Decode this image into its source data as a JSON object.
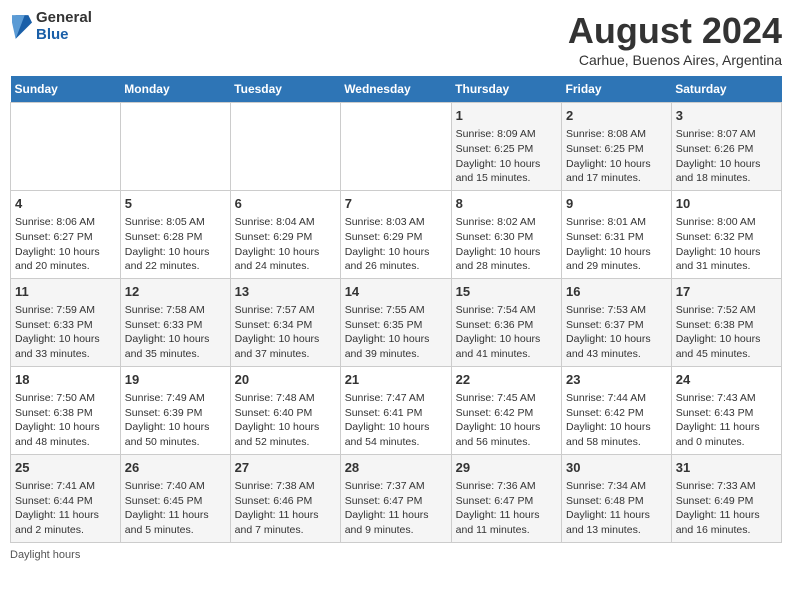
{
  "header": {
    "logo": {
      "general": "General",
      "blue": "Blue"
    },
    "title": "August 2024",
    "subtitle": "Carhue, Buenos Aires, Argentina"
  },
  "days_of_week": [
    "Sunday",
    "Monday",
    "Tuesday",
    "Wednesday",
    "Thursday",
    "Friday",
    "Saturday"
  ],
  "weeks": [
    [
      {
        "day": "",
        "info": ""
      },
      {
        "day": "",
        "info": ""
      },
      {
        "day": "",
        "info": ""
      },
      {
        "day": "",
        "info": ""
      },
      {
        "day": "1",
        "info": "Sunrise: 8:09 AM\nSunset: 6:25 PM\nDaylight: 10 hours\nand 15 minutes."
      },
      {
        "day": "2",
        "info": "Sunrise: 8:08 AM\nSunset: 6:25 PM\nDaylight: 10 hours\nand 17 minutes."
      },
      {
        "day": "3",
        "info": "Sunrise: 8:07 AM\nSunset: 6:26 PM\nDaylight: 10 hours\nand 18 minutes."
      }
    ],
    [
      {
        "day": "4",
        "info": "Sunrise: 8:06 AM\nSunset: 6:27 PM\nDaylight: 10 hours\nand 20 minutes."
      },
      {
        "day": "5",
        "info": "Sunrise: 8:05 AM\nSunset: 6:28 PM\nDaylight: 10 hours\nand 22 minutes."
      },
      {
        "day": "6",
        "info": "Sunrise: 8:04 AM\nSunset: 6:29 PM\nDaylight: 10 hours\nand 24 minutes."
      },
      {
        "day": "7",
        "info": "Sunrise: 8:03 AM\nSunset: 6:29 PM\nDaylight: 10 hours\nand 26 minutes."
      },
      {
        "day": "8",
        "info": "Sunrise: 8:02 AM\nSunset: 6:30 PM\nDaylight: 10 hours\nand 28 minutes."
      },
      {
        "day": "9",
        "info": "Sunrise: 8:01 AM\nSunset: 6:31 PM\nDaylight: 10 hours\nand 29 minutes."
      },
      {
        "day": "10",
        "info": "Sunrise: 8:00 AM\nSunset: 6:32 PM\nDaylight: 10 hours\nand 31 minutes."
      }
    ],
    [
      {
        "day": "11",
        "info": "Sunrise: 7:59 AM\nSunset: 6:33 PM\nDaylight: 10 hours\nand 33 minutes."
      },
      {
        "day": "12",
        "info": "Sunrise: 7:58 AM\nSunset: 6:33 PM\nDaylight: 10 hours\nand 35 minutes."
      },
      {
        "day": "13",
        "info": "Sunrise: 7:57 AM\nSunset: 6:34 PM\nDaylight: 10 hours\nand 37 minutes."
      },
      {
        "day": "14",
        "info": "Sunrise: 7:55 AM\nSunset: 6:35 PM\nDaylight: 10 hours\nand 39 minutes."
      },
      {
        "day": "15",
        "info": "Sunrise: 7:54 AM\nSunset: 6:36 PM\nDaylight: 10 hours\nand 41 minutes."
      },
      {
        "day": "16",
        "info": "Sunrise: 7:53 AM\nSunset: 6:37 PM\nDaylight: 10 hours\nand 43 minutes."
      },
      {
        "day": "17",
        "info": "Sunrise: 7:52 AM\nSunset: 6:38 PM\nDaylight: 10 hours\nand 45 minutes."
      }
    ],
    [
      {
        "day": "18",
        "info": "Sunrise: 7:50 AM\nSunset: 6:38 PM\nDaylight: 10 hours\nand 48 minutes."
      },
      {
        "day": "19",
        "info": "Sunrise: 7:49 AM\nSunset: 6:39 PM\nDaylight: 10 hours\nand 50 minutes."
      },
      {
        "day": "20",
        "info": "Sunrise: 7:48 AM\nSunset: 6:40 PM\nDaylight: 10 hours\nand 52 minutes."
      },
      {
        "day": "21",
        "info": "Sunrise: 7:47 AM\nSunset: 6:41 PM\nDaylight: 10 hours\nand 54 minutes."
      },
      {
        "day": "22",
        "info": "Sunrise: 7:45 AM\nSunset: 6:42 PM\nDaylight: 10 hours\nand 56 minutes."
      },
      {
        "day": "23",
        "info": "Sunrise: 7:44 AM\nSunset: 6:42 PM\nDaylight: 10 hours\nand 58 minutes."
      },
      {
        "day": "24",
        "info": "Sunrise: 7:43 AM\nSunset: 6:43 PM\nDaylight: 11 hours\nand 0 minutes."
      }
    ],
    [
      {
        "day": "25",
        "info": "Sunrise: 7:41 AM\nSunset: 6:44 PM\nDaylight: 11 hours\nand 2 minutes."
      },
      {
        "day": "26",
        "info": "Sunrise: 7:40 AM\nSunset: 6:45 PM\nDaylight: 11 hours\nand 5 minutes."
      },
      {
        "day": "27",
        "info": "Sunrise: 7:38 AM\nSunset: 6:46 PM\nDaylight: 11 hours\nand 7 minutes."
      },
      {
        "day": "28",
        "info": "Sunrise: 7:37 AM\nSunset: 6:47 PM\nDaylight: 11 hours\nand 9 minutes."
      },
      {
        "day": "29",
        "info": "Sunrise: 7:36 AM\nSunset: 6:47 PM\nDaylight: 11 hours\nand 11 minutes."
      },
      {
        "day": "30",
        "info": "Sunrise: 7:34 AM\nSunset: 6:48 PM\nDaylight: 11 hours\nand 13 minutes."
      },
      {
        "day": "31",
        "info": "Sunrise: 7:33 AM\nSunset: 6:49 PM\nDaylight: 11 hours\nand 16 minutes."
      }
    ]
  ],
  "footer": {
    "daylight_label": "Daylight hours"
  }
}
